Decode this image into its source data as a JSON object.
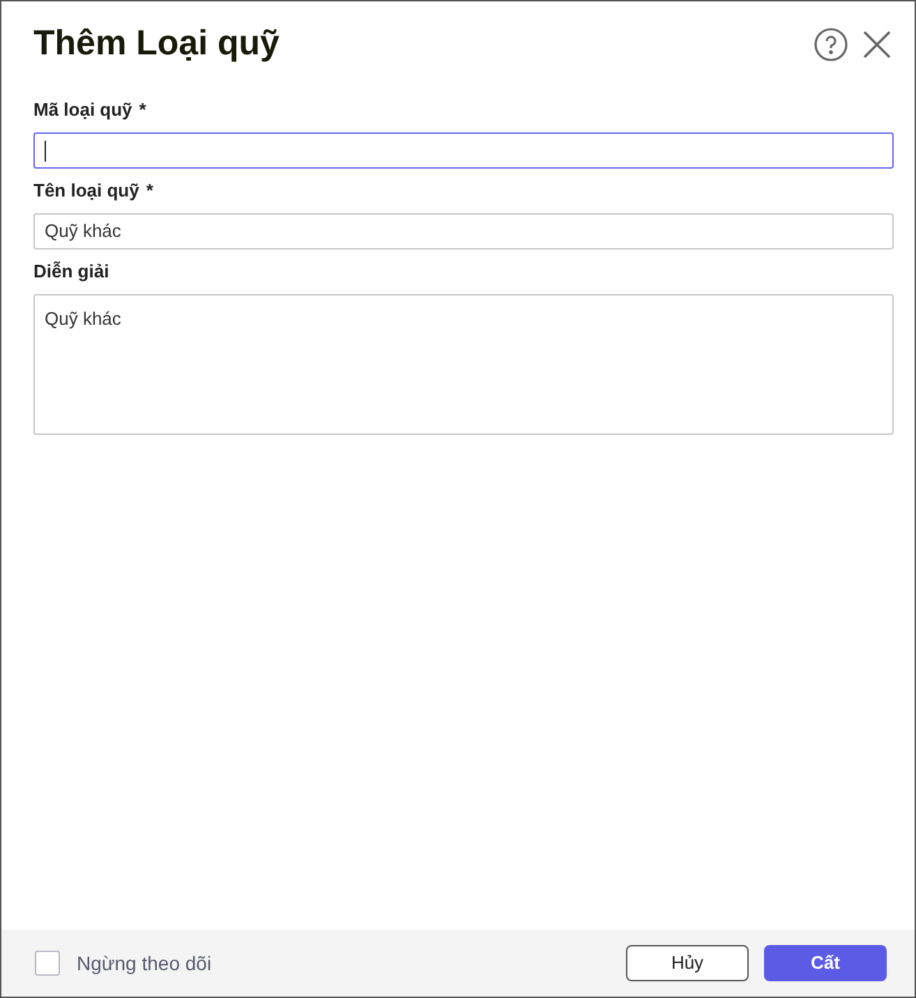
{
  "dialog": {
    "title": "Thêm Loại quỹ"
  },
  "fields": [
    {
      "kind": "input",
      "label": "Mã loại quỹ",
      "required": true,
      "focused": true
    },
    {
      "kind": "input",
      "label": "Tên loại quỹ",
      "required": true,
      "value": "Quỹ khác",
      "focused": false
    },
    {
      "kind": "textarea",
      "label": "Diễn giải",
      "required": false,
      "value": "Quỹ khác",
      "focused": false
    }
  ],
  "required_mark": "*",
  "footer": {
    "checkbox": {
      "label": "Ngừng theo dõi",
      "checked": false
    },
    "buttons": [
      {
        "label": "Hủy",
        "kind": "secondary"
      },
      {
        "label": "Cất",
        "kind": "primary"
      }
    ]
  }
}
